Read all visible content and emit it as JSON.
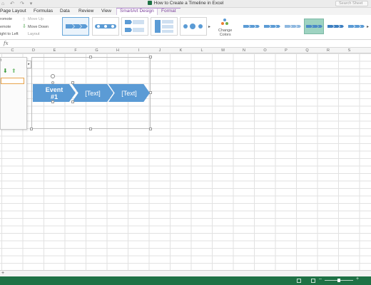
{
  "window": {
    "title": "How to Create a Timeline in Excel",
    "search_placeholder": "Search Sheet"
  },
  "tabs": [
    {
      "label": "Page Layout"
    },
    {
      "label": "Formulas"
    },
    {
      "label": "Data"
    },
    {
      "label": "Review"
    },
    {
      "label": "View"
    },
    {
      "label": "SmartArt Design"
    },
    {
      "label": "Format"
    }
  ],
  "ribbon": {
    "left_labels": [
      "romote",
      "emote",
      "ight to Left"
    ],
    "move_up": "Move Up",
    "move_down": "Move Down",
    "layout": "Layout",
    "change_colors": "Change\nColors"
  },
  "formula_bar": {
    "fx": "fx",
    "value": ""
  },
  "columns": [
    "C",
    "D",
    "E",
    "F",
    "G",
    "H",
    "I",
    "J",
    "K",
    "L",
    "M",
    "N",
    "O",
    "P",
    "Q",
    "R",
    "S"
  ],
  "text_pane": {
    "title": "t",
    "tab_glyph": "▸"
  },
  "smartart": {
    "items": [
      "Event\n#1",
      "[Text]",
      "[Text]"
    ],
    "color": "#5b9bd5"
  },
  "colors": {
    "status_bar": "#1e7145",
    "accent_tab": "#7a3f9a"
  }
}
